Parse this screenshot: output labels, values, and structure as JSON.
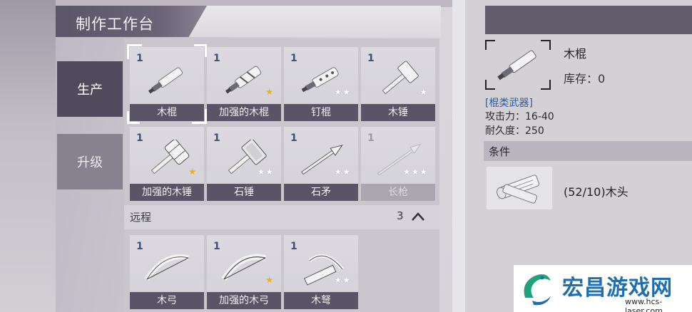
{
  "window_title": "制作工作台",
  "side_tabs": [
    {
      "label": "生产",
      "active": true
    },
    {
      "label": "升级",
      "active": false
    }
  ],
  "melee_items": [
    {
      "count": "1",
      "label": "木棍",
      "stars": "",
      "star_color": "",
      "selected": true,
      "dim": false,
      "icon": "wooden-stick-icon"
    },
    {
      "count": "1",
      "label": "加强的木棍",
      "stars": "★",
      "star_color": "gold",
      "selected": false,
      "dim": false,
      "icon": "reinforced-stick-icon"
    },
    {
      "count": "1",
      "label": "钉棍",
      "stars": "★★",
      "star_color": "white",
      "selected": false,
      "dim": false,
      "icon": "nail-club-icon"
    },
    {
      "count": "1",
      "label": "木锤",
      "stars": "★",
      "star_color": "white",
      "selected": false,
      "dim": false,
      "icon": "wooden-hammer-icon"
    },
    {
      "count": "1",
      "label": "加强的木锤",
      "stars": "★",
      "star_color": "gold",
      "selected": false,
      "dim": false,
      "icon": "reinforced-hammer-icon"
    },
    {
      "count": "1",
      "label": "石锤",
      "stars": "★★",
      "star_color": "white",
      "selected": false,
      "dim": false,
      "icon": "stone-hammer-icon"
    },
    {
      "count": "1",
      "label": "石矛",
      "stars": "★★",
      "star_color": "white",
      "selected": false,
      "dim": false,
      "icon": "stone-spear-icon"
    },
    {
      "count": "1",
      "label": "长枪",
      "stars": "★★★",
      "star_color": "white",
      "selected": false,
      "dim": true,
      "icon": "long-spear-icon"
    }
  ],
  "ranged_section": {
    "title": "远程",
    "count": "3"
  },
  "ranged_items": [
    {
      "count": "1",
      "label": "木弓",
      "stars": "",
      "star_color": "",
      "icon": "wooden-bow-icon"
    },
    {
      "count": "1",
      "label": "加强的木弓",
      "stars": "★",
      "star_color": "gold",
      "icon": "reinforced-bow-icon"
    },
    {
      "count": "1",
      "label": "木弩",
      "stars": "★★",
      "star_color": "white",
      "icon": "crossbow-icon"
    }
  ],
  "detail": {
    "name": "木棍",
    "stock": "库存：0",
    "type": "[棍类武器]",
    "attack": "攻击力：16-40",
    "durability": "耐久度：250",
    "conditions_label": "条件",
    "material": "(52/10)木头"
  },
  "watermark": {
    "title": "宏昌游戏网",
    "url": "www.hcs-laser.com"
  },
  "colors": {
    "accent_dark": "#5a5566",
    "gold_star": "#e8b21c",
    "type_blue": "#2f5a9c",
    "watermark_blue": "#1f6fb0"
  }
}
